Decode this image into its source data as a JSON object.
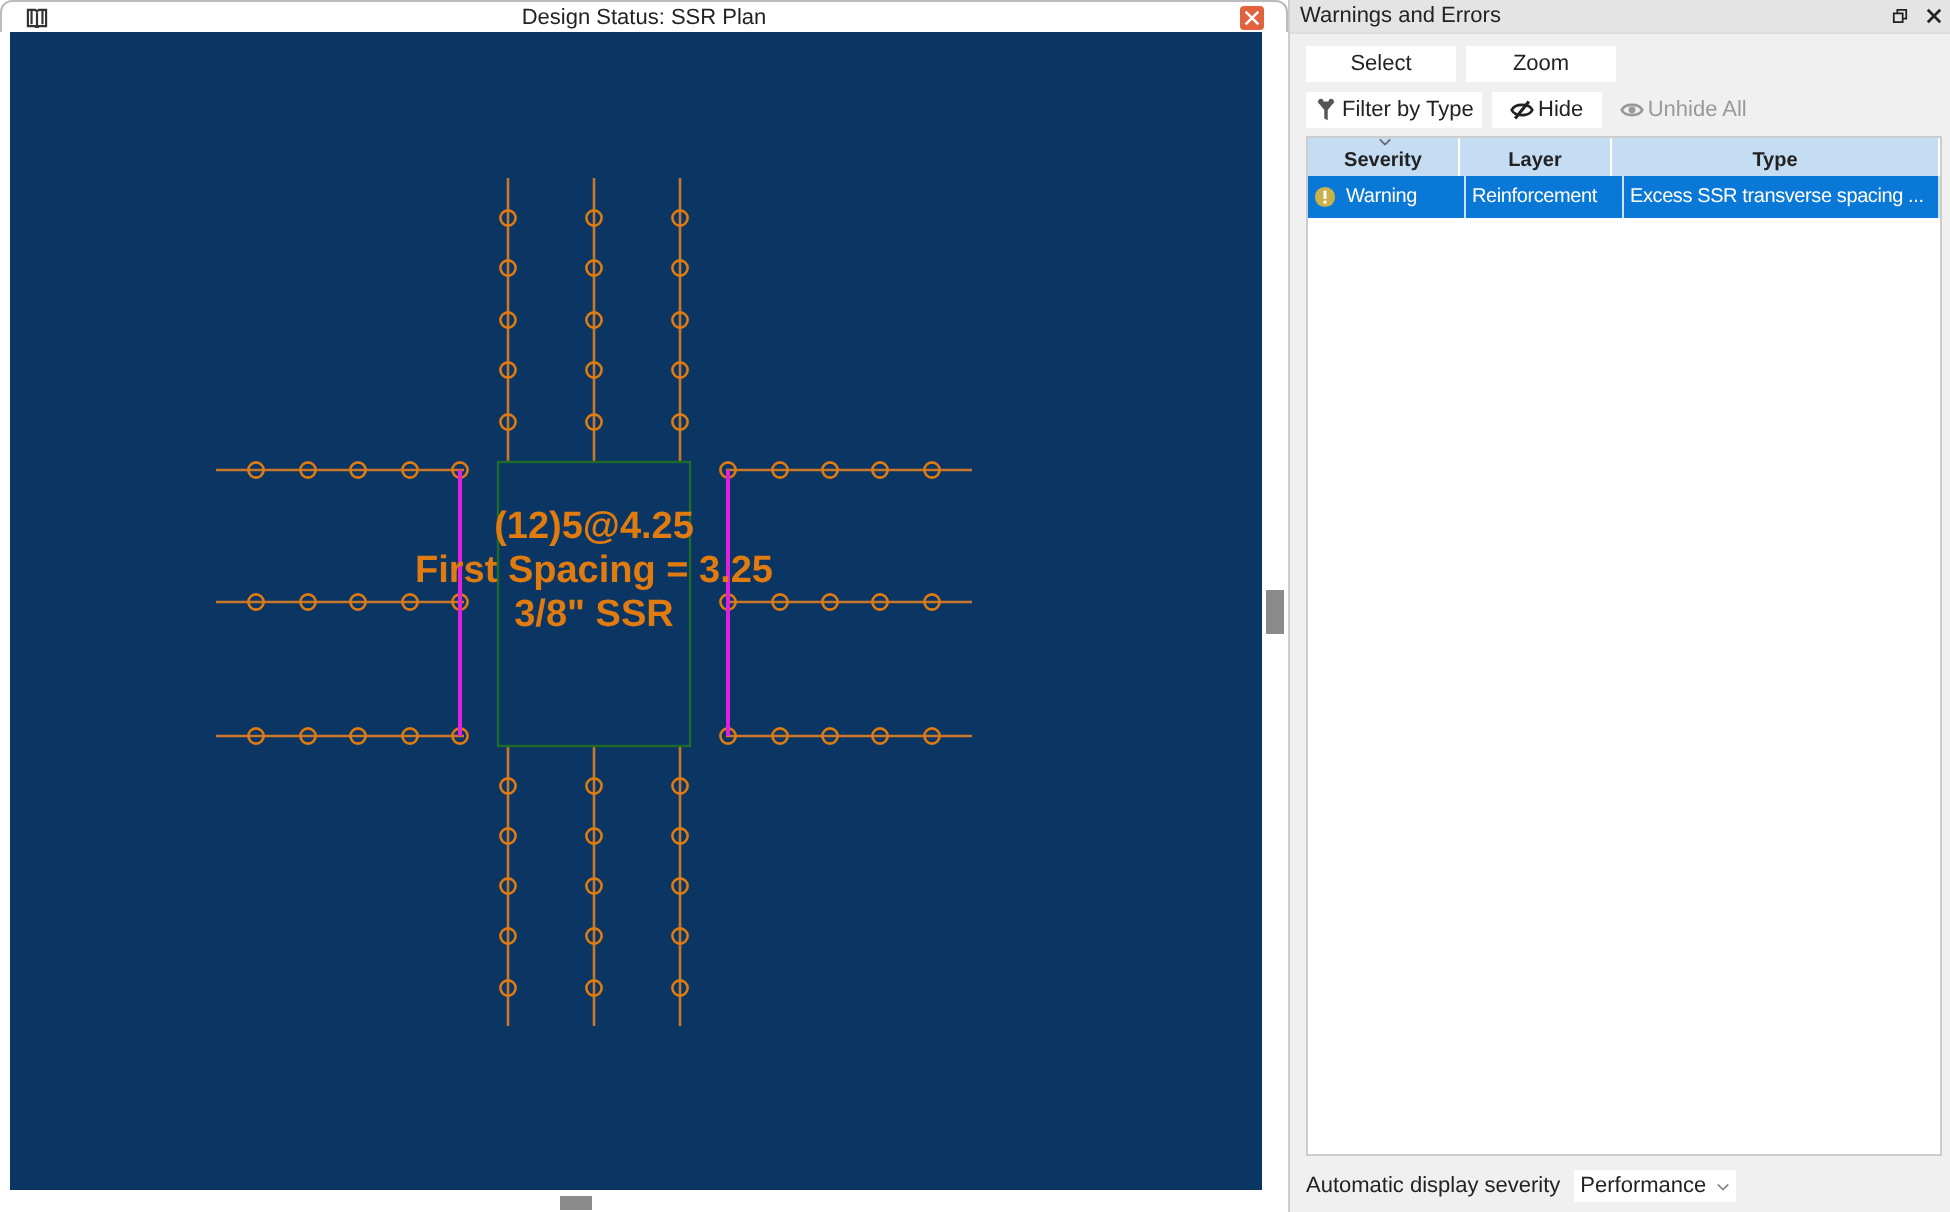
{
  "plan_window": {
    "title": "Design Status: SSR Plan",
    "label_lines": [
      "(12)5@4.25",
      "First Spacing = 3.25",
      "3/8\" SSR"
    ]
  },
  "panel": {
    "title": "Warnings and Errors",
    "buttons": [
      {
        "label": "Select",
        "disabled": false
      },
      {
        "label": "Zoom",
        "disabled": false
      }
    ],
    "tools": [
      {
        "label": "Filter by Type",
        "kind": "filter",
        "disabled": false
      },
      {
        "label": "Hide",
        "kind": "hide",
        "disabled": false
      },
      {
        "label": "Unhide All",
        "kind": "unhide",
        "disabled": true
      }
    ],
    "table": {
      "columns": [
        "Severity",
        "Layer",
        "Type"
      ],
      "rows": [
        {
          "cells": [
            "Warning",
            "Reinforcement",
            "Excess SSR transverse spacing ..."
          ],
          "kind": "warning",
          "selected": true
        }
      ]
    },
    "footer": {
      "label": "Automatic display severity",
      "value": "Performance"
    }
  }
}
